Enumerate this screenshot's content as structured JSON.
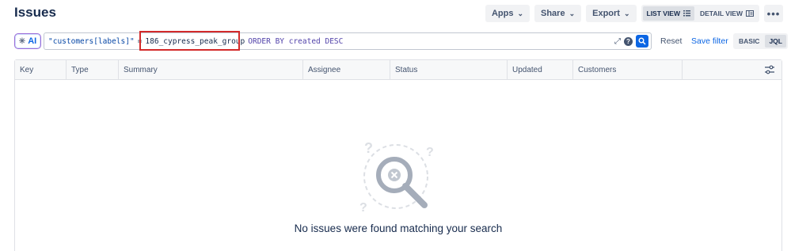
{
  "page": {
    "title": "Issues"
  },
  "toolbar": {
    "apps_label": "Apps",
    "share_label": "Share",
    "export_label": "Export",
    "list_view_label": "LIST VIEW",
    "detail_view_label": "DETAIL VIEW",
    "more_label": "•••"
  },
  "search": {
    "ai_label": "AI",
    "jql_field": "\"customers[labels]\"",
    "jql_operator": "=",
    "jql_value": "186_cypress_peak_group",
    "jql_order": "ORDER BY created DESC",
    "reset_label": "Reset",
    "save_filter_label": "Save filter",
    "basic_label": "BASIC",
    "jql_label": "JQL"
  },
  "table": {
    "columns": [
      "Key",
      "Type",
      "Summary",
      "Assignee",
      "Status",
      "Updated",
      "Customers"
    ]
  },
  "empty": {
    "message": "No issues were found matching your search"
  },
  "colors": {
    "accent": "#0c66e4",
    "highlight": "#d32a2a",
    "text": "#172b4d"
  }
}
